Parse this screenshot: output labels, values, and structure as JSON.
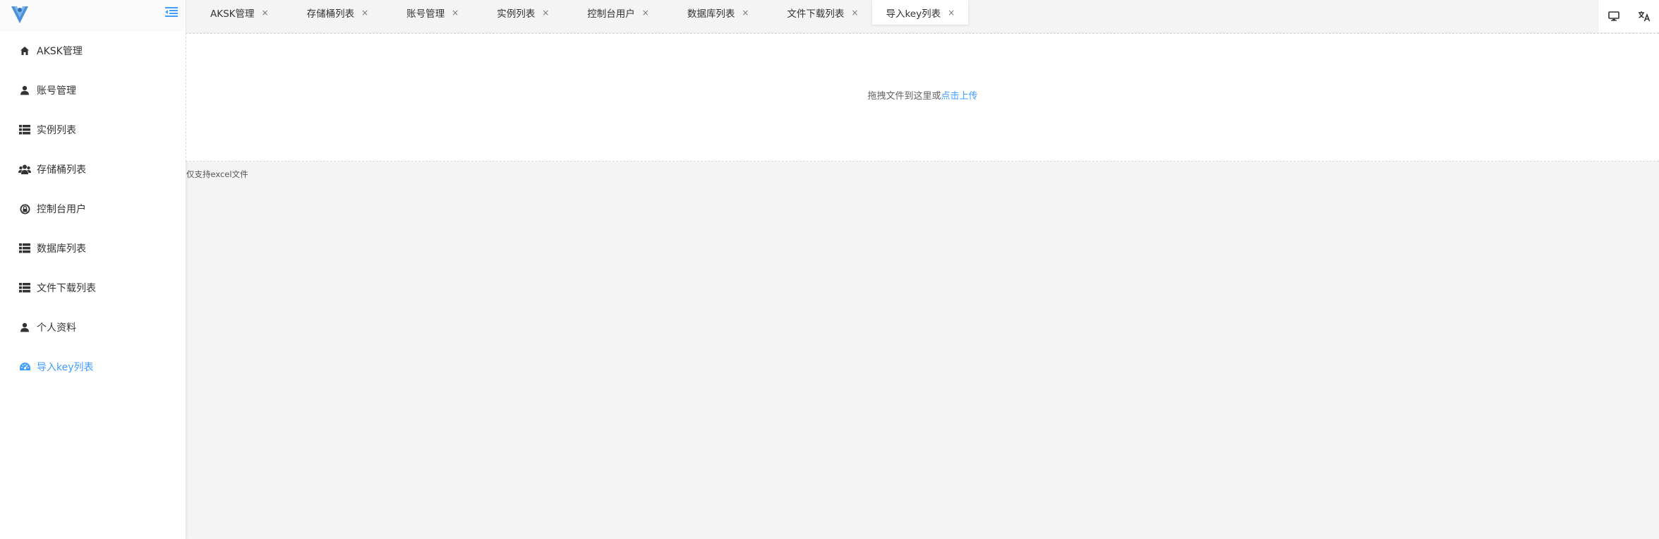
{
  "sidebar": {
    "items": [
      {
        "label": "AKSK管理",
        "icon": "home-icon"
      },
      {
        "label": "账号管理",
        "icon": "user-icon"
      },
      {
        "label": "实例列表",
        "icon": "list-icon"
      },
      {
        "label": "存储桶列表",
        "icon": "users-icon"
      },
      {
        "label": "控制台用户",
        "icon": "lock-user-icon"
      },
      {
        "label": "数据库列表",
        "icon": "list-icon"
      },
      {
        "label": "文件下载列表",
        "icon": "list-icon"
      },
      {
        "label": "个人资料",
        "icon": "user-icon"
      },
      {
        "label": "导入key列表",
        "icon": "dashboard-icon",
        "active": true
      }
    ]
  },
  "tabs": [
    {
      "label": "AKSK管理"
    },
    {
      "label": "存储桶列表"
    },
    {
      "label": "账号管理"
    },
    {
      "label": "实例列表"
    },
    {
      "label": "控制台用户"
    },
    {
      "label": "数据库列表"
    },
    {
      "label": "文件下载列表"
    },
    {
      "label": "导入key列表",
      "active": true
    }
  ],
  "tab_close_glyph": "×",
  "upload": {
    "drag_text": "拖拽文件到这里或",
    "click_text": "点击上传",
    "tip": "仅支持excel文件"
  },
  "colors": {
    "accent": "#409eff",
    "logo_dark": "#35495e",
    "logo_light": "#41b883"
  }
}
